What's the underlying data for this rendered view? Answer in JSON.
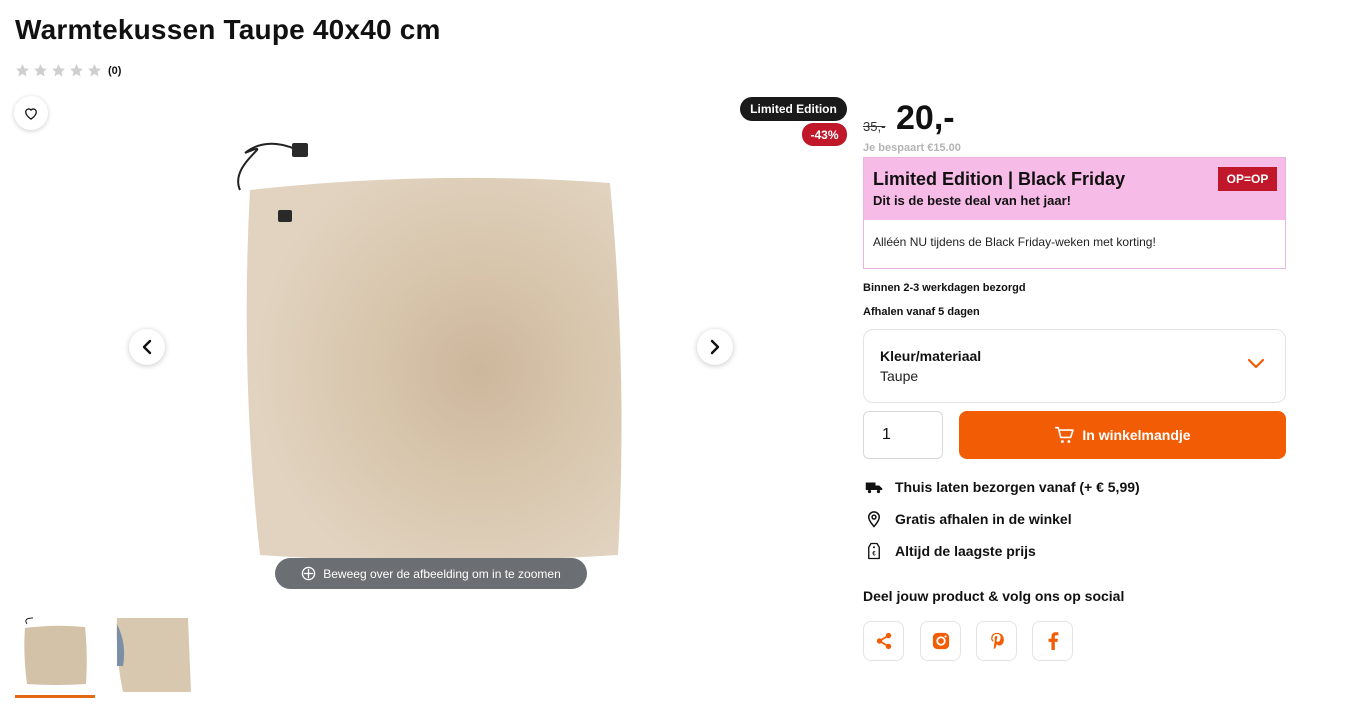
{
  "product": {
    "title": "Warmtekussen Taupe 40x40 cm",
    "rating_count": "(0)",
    "stars_filled": 0,
    "stars_total": 5
  },
  "gallery": {
    "badge_limited": "Limited Edition",
    "badge_discount": "-43%",
    "zoom_hint": "Beweeg over de afbeelding om in te zoomen"
  },
  "price": {
    "old": "35,-",
    "new": "20,-",
    "savings": "Je bespaart €15.00"
  },
  "promo": {
    "title": "Limited Edition | Black Friday",
    "subtitle": "Dit is de beste deal van het jaar!",
    "badge": "OP=OP",
    "body": "Alléén NU tijdens de Black Friday-weken met korting!"
  },
  "delivery": {
    "line1": "Binnen 2-3 werkdagen bezorgd",
    "line2": "Afhalen vanaf 5 dagen"
  },
  "variant": {
    "label": "Kleur/materiaal",
    "value": "Taupe"
  },
  "cart": {
    "quantity": "1",
    "add_label": "In winkelmandje"
  },
  "usps": {
    "delivery": "Thuis laten bezorgen vanaf (+ € 5,99)",
    "pickup": "Gratis afhalen in de winkel",
    "price": "Altijd de laagste prijs"
  },
  "social": {
    "title": "Deel jouw product & volg ons op social"
  },
  "colors": {
    "accent": "#f25c05",
    "discount_red": "#c0182a",
    "promo_pink": "#f7bbe8",
    "pillow": "#d7c5ad"
  }
}
